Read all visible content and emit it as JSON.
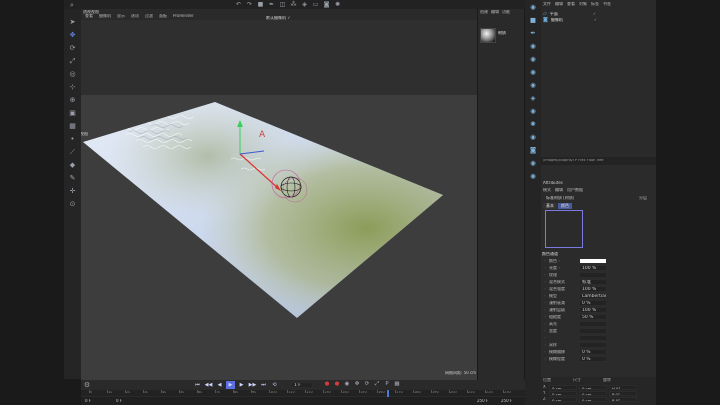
{
  "viewport": {
    "menu": [
      "查看",
      "摄像机",
      "显示",
      "选项",
      "过滤",
      "面板",
      "ProRender"
    ],
    "title": "透视视图",
    "camera_label": "默认摄像机 ✓",
    "grid_label": "网格间距: 50 cm",
    "side_label": "视图",
    "marker": "▽"
  },
  "left_tools": [
    "cursor-icon",
    "move-icon",
    "rotate-icon",
    "scale-icon",
    "live-select-icon",
    "transform-icon",
    "coord-icon",
    "model-icon",
    "texture-icon",
    "point-icon",
    "edge-icon",
    "polygon-icon",
    "paint-icon",
    "axis-icon",
    "snap-icon"
  ],
  "top_icons": [
    "undo-icon",
    "redo-icon",
    "cube-icon",
    "pen-icon",
    "subdivide-icon",
    "array-icon",
    "deformer-icon",
    "floor-icon",
    "camera-icon",
    "light-icon"
  ],
  "timeline": {
    "ticks": [
      "0",
      "10",
      "20",
      "30",
      "40",
      "50",
      "60",
      "70",
      "80",
      "90",
      "100",
      "110",
      "120",
      "130",
      "140",
      "150",
      "160",
      "170",
      "180",
      "190",
      "200",
      "210",
      "220",
      "230"
    ],
    "frame_start": "0 F",
    "frame_current": "0 F",
    "frame_end": "250 F",
    "frame_end2": "250 F",
    "frame_field": "1 F"
  },
  "material_mgr": {
    "menu": [
      "创建",
      "编辑",
      "功能"
    ],
    "material_name": "材质"
  },
  "object_mgr": {
    "menu": [
      "文件",
      "编辑",
      "查看",
      "对象",
      "标签",
      "书签"
    ],
    "objects": [
      {
        "name": "平面",
        "tag": "✓"
      },
      {
        "name": "摄像机",
        "tag": "✓"
      }
    ]
  },
  "layer_path": "/images/plugins/TP Flex Flow Tree",
  "attributes": {
    "mode": "Attributes",
    "menu": [
      "模式",
      "编辑",
      "用户数据"
    ],
    "title": "标准材质 [材质]",
    "tabs": [
      "基本",
      "颜色"
    ],
    "preset": "分层",
    "section": "颜色通道",
    "rows": [
      {
        "label": "颜色 ◦",
        "value": ""
      },
      {
        "label": "亮度 ◦",
        "value": "100 %"
      },
      {
        "label": "纹理",
        "value": ""
      },
      {
        "label": "混合模式",
        "value": "标准"
      },
      {
        "label": "混合强度",
        "value": "100 %"
      },
      {
        "label": "模型",
        "value": "Lambertian"
      },
      {
        "label": "漫射衰减",
        "value": "0 %"
      },
      {
        "label": "漫射层级",
        "value": "100 %"
      },
      {
        "label": "粗糙度",
        "value": "50 %"
      },
      {
        "label": "高光",
        "value": ""
      },
      {
        "label": "宽度",
        "value": ""
      },
      {
        "label": "",
        "value": ""
      },
      {
        "label": "采样",
        "value": ""
      },
      {
        "label": "模糊偏移",
        "value": "0 %"
      },
      {
        "label": "模糊程度",
        "value": "0 %"
      }
    ]
  },
  "coords": {
    "headers": [
      "位置",
      "尺寸",
      "旋转"
    ],
    "rows": [
      {
        "axis": "X",
        "p": "0 cm",
        "s": "0 cm",
        "r": "H 0°"
      },
      {
        "axis": "Y",
        "p": "0 cm",
        "s": "0 cm",
        "r": "P 0°"
      },
      {
        "axis": "Z",
        "p": "0 cm",
        "s": "0 cm",
        "r": "B 0°"
      }
    ],
    "mode": "对象(相对)",
    "size_mode": "绝对尺寸",
    "apply": "应用"
  },
  "colors": {
    "accent": "#5a6ee0",
    "record": "#d23c3c",
    "playhead": "#4a7ad8"
  }
}
